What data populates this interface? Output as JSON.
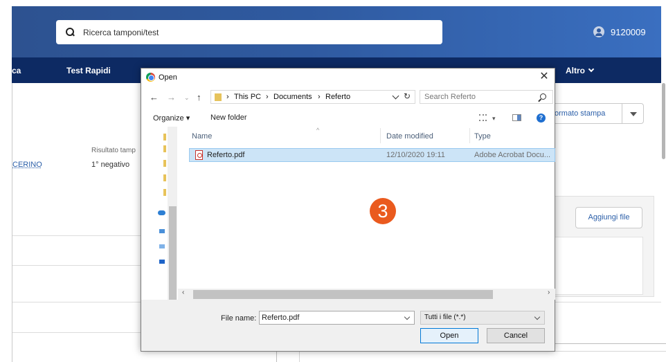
{
  "app": {
    "search": {
      "value": "Ricerca tamponi/test"
    },
    "user": {
      "id": "9120009"
    },
    "nav": {
      "partial_left": "ca",
      "test_rapidi": "Test Rapidi",
      "altro": "Altro"
    },
    "record": {
      "link_partial": "CERINO",
      "result_label_partial": "Risultato tamp",
      "result_value": "1° negativo"
    },
    "print_button_partial": "ormato stampa",
    "add_file_button": "Aggiungi file"
  },
  "dialog": {
    "title": "Open",
    "breadcrumb": [
      "This PC",
      "Documents",
      "Referto"
    ],
    "search_placeholder": "Search Referto",
    "toolbar": {
      "organize": "Organize",
      "new_folder": "New folder"
    },
    "columns": {
      "name": "Name",
      "date_modified": "Date modified",
      "type": "Type"
    },
    "files": [
      {
        "name": "Referto.pdf",
        "date_modified": "12/10/2020 19:11",
        "type": "Adobe Acrobat Docu..."
      }
    ],
    "file_name_label": "File name:",
    "file_name_value": "Referto.pdf",
    "file_type_value": "Tutti i file (*.*)",
    "open_button": "Open",
    "cancel_button": "Cancel"
  },
  "step_badge": "3",
  "colors": {
    "header": "#2f5aa0",
    "nav": "#0d2a63",
    "badge": "#ea5a1e",
    "selection": "#cce4f7"
  }
}
